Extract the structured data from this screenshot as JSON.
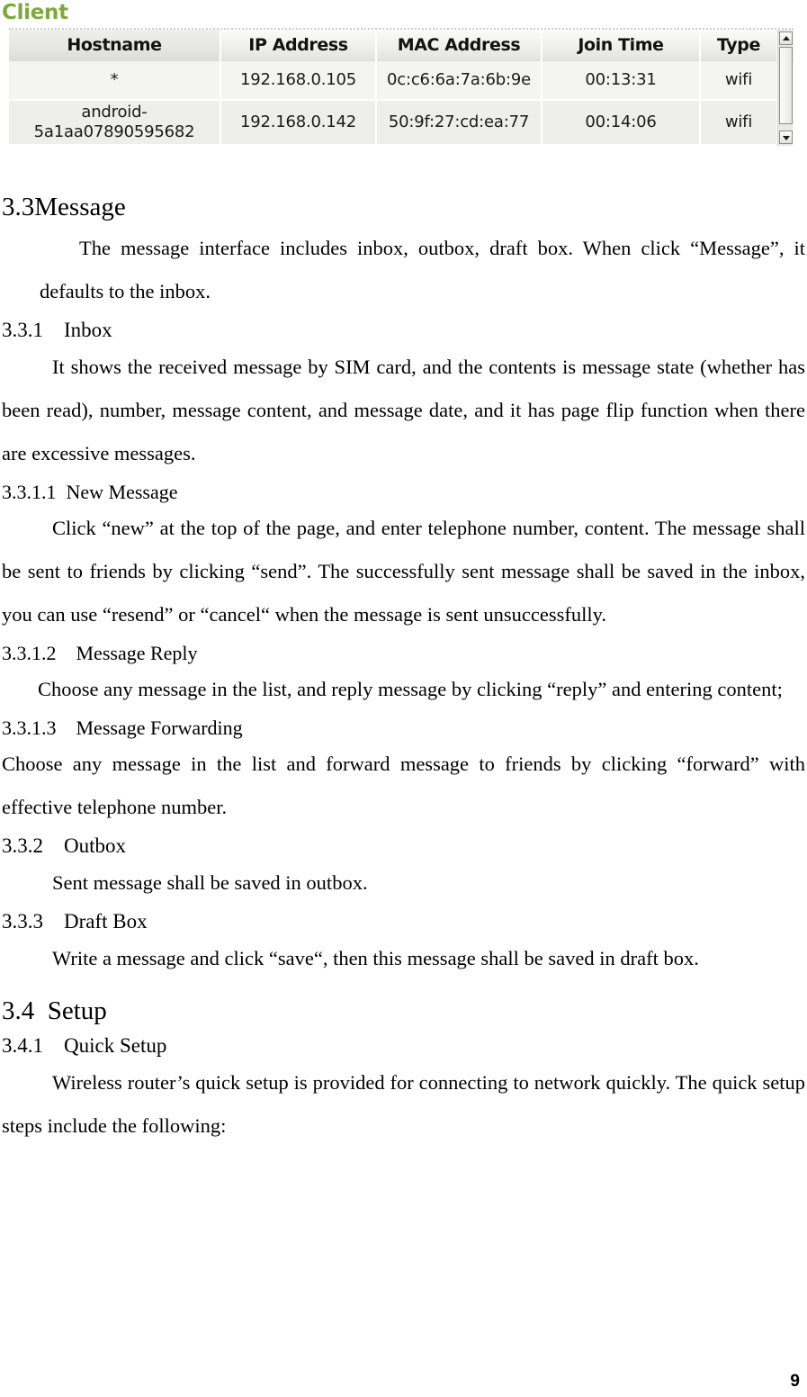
{
  "figure": {
    "title": "Client",
    "title_color": "#7fa83c",
    "table": {
      "columns": [
        "Hostname",
        "IP Address",
        "MAC Address",
        "Join Time",
        "Type"
      ],
      "rows": [
        {
          "hostname": "*",
          "ip_address": "192.168.0.105",
          "mac_address": "0c:c6:6a:7a:6b:9e",
          "join_time": "00:13:31",
          "type": "wifi"
        },
        {
          "hostname": "android-5a1aa07890595682",
          "ip_address": "192.168.0.142",
          "mac_address": "50:9f:27:cd:ea:77",
          "join_time": "00:14:06",
          "type": "wifi"
        }
      ]
    },
    "scrollbar": {
      "up_arrow": "scroll-up-arrow",
      "down_arrow": "scroll-down-arrow"
    }
  },
  "document": {
    "sections": [
      {
        "level": "h2",
        "number": "3.3",
        "title": "Message",
        "heading": "3.3Message"
      },
      {
        "level": "p",
        "text": "The message interface includes inbox, outbox, draft box. When click “Message”, it defaults to the inbox."
      },
      {
        "level": "h3",
        "number": "3.3.1",
        "title": "Inbox",
        "heading": "3.3.1 Inbox"
      },
      {
        "level": "p",
        "text": "It shows the received message by SIM card, and the contents is message state (whether has been read), number, message content, and message date, and it has page flip function when there are excessive messages."
      },
      {
        "level": "h4",
        "number": "3.3.1.1",
        "title": "New Message",
        "heading": "3.3.1.1 New Message"
      },
      {
        "level": "p",
        "text": "Click “new” at the top of the page, and enter telephone number, content. The message shall be sent to friends by clicking “send”. The successfully sent message shall be saved in the inbox, you can use “resend” or “cancel“ when the message is sent unsuccessfully."
      },
      {
        "level": "h4",
        "number": "3.3.1.2",
        "title": "Message Reply",
        "heading": "3.3.1.2 Message Reply"
      },
      {
        "level": "p",
        "text": "Choose any message in the list, and reply message by clicking “reply” and entering content;"
      },
      {
        "level": "h4",
        "number": "3.3.1.3",
        "title": "Message Forwarding",
        "heading": "3.3.1.3 Message Forwarding"
      },
      {
        "level": "p",
        "text": "Choose any message in the list and forward message to friends by clicking “forward” with effective telephone number."
      },
      {
        "level": "h3",
        "number": "3.3.2",
        "title": "Outbox",
        "heading": "3.3.2 Outbox"
      },
      {
        "level": "p",
        "text": "Sent message shall be saved in outbox."
      },
      {
        "level": "h3",
        "number": "3.3.3",
        "title": "Draft Box",
        "heading": "3.3.3 Draft Box"
      },
      {
        "level": "p",
        "text": "Write a message and click “save“, then this message shall be saved in draft box."
      },
      {
        "level": "h2",
        "number": "3.4",
        "title": "Setup",
        "heading": "3.4 Setup"
      },
      {
        "level": "h3",
        "number": "3.4.1",
        "title": "Quick Setup",
        "heading": "3.4.1 Quick Setup"
      },
      {
        "level": "p",
        "text": "Wireless router’s quick setup is provided for connecting to network quickly. The quick setup steps include the following:"
      }
    ],
    "page_number": "9"
  }
}
